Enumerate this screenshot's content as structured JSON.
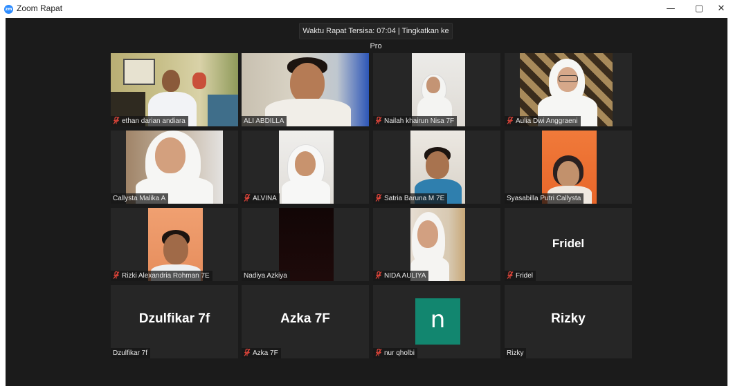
{
  "window": {
    "app_icon_text": "zm",
    "title": "Zoom Rapat",
    "minimize": "—",
    "maximize": "▢",
    "close": "✕"
  },
  "meeting": {
    "timer_text": "Waktu Rapat Tersisa: 07:04 | Tingkatkan ke Pro"
  },
  "colors": {
    "active_speaker_outline": "#d8e14a",
    "muted_icon": "#e0453a",
    "avatar_n_bg": "#12866f",
    "meeting_bg": "#1b1b1b",
    "tile_bg": "#262626"
  },
  "participants": [
    {
      "name": "ethan darian andiara",
      "muted": true
    },
    {
      "name": "ALI ABDILLA",
      "muted": false,
      "active": true
    },
    {
      "name": "Nailah khairun Nisa 7F",
      "muted": true
    },
    {
      "name": "Aulia Dwi Anggraeni",
      "muted": true
    },
    {
      "name": "Callysta Malika A",
      "muted": false
    },
    {
      "name": "ALVINA",
      "muted": true
    },
    {
      "name": "Satria Baruna M 7E",
      "muted": true
    },
    {
      "name": "Syasabilla Putri Callysta",
      "muted": false
    },
    {
      "name": "Rizki Alexandria Rohman 7E",
      "muted": true
    },
    {
      "name": "Nadiya Azkiya",
      "muted": false
    },
    {
      "name": "NIDA AULIYA",
      "muted": true
    },
    {
      "name": "Fridel",
      "muted": true,
      "display": "Fridel"
    },
    {
      "name": "Dzulfikar 7f",
      "muted": false,
      "display": "Dzulfikar 7f"
    },
    {
      "name": "Azka 7F",
      "muted": true,
      "display": "Azka 7F"
    },
    {
      "name": "nur qholbi",
      "muted": true,
      "avatar_letter": "n"
    },
    {
      "name": "Rizky",
      "muted": false,
      "display": "Rizky"
    }
  ]
}
